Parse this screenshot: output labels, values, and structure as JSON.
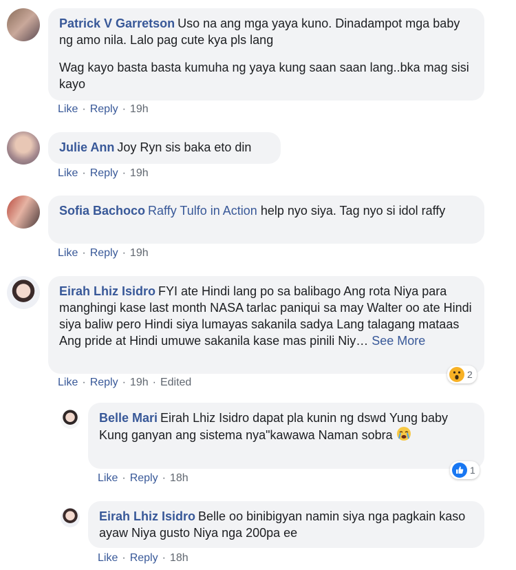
{
  "comments": [
    {
      "author": "Patrick V Garretson",
      "text1": "Uso na ang mga yaya kuno. Dinadampot mga baby ng amo nila. Lalo pag cute kya pls lang",
      "text2": "Wag kayo basta basta kumuha ng yaya kung saan saan lang..bka mag sisi kayo",
      "like": "Like",
      "reply": "Reply",
      "time": "19h"
    },
    {
      "author": "Julie Ann",
      "text": "Joy Ryn sis baka eto din",
      "like": "Like",
      "reply": "Reply",
      "time": "19h"
    },
    {
      "author": "Sofia Bachoco",
      "mention": "Raffy Tulfo in Action",
      "text": "help nyo siya. Tag nyo si idol raffy",
      "like": "Like",
      "reply": "Reply",
      "time": "19h"
    },
    {
      "author": "Eirah Lhiz Isidro",
      "text": "FYI ate Hindi lang po sa balibago Ang rota Niya para manghingi kase last month NASA tarlac paniqui sa may Walter oo ate Hindi siya baliw pero Hindi siya lumayas sakanila sadya Lang talagang mataas Ang pride at Hindi umuwe sakanila kase mas pinili Niy…",
      "see_more": "See More",
      "like": "Like",
      "reply": "Reply",
      "time": "19h",
      "edited": "Edited",
      "reaction_count": "2",
      "reaction_icon": "wow-emoji-icon"
    }
  ],
  "replies": [
    {
      "author": "Belle Mari",
      "text": "Eirah Lhiz Isidro dapat pla kunin ng dswd Yung baby Kung ganyan ang sistema nya\"kawawa Naman sobra",
      "like": "Like",
      "reply": "Reply",
      "time": "18h",
      "reaction_count": "1",
      "reaction_icon": "thumbs-up-icon"
    },
    {
      "author": "Eirah Lhiz Isidro",
      "text": "Belle oo binibigyan namin siya nga pagkain kaso ayaw Niya gusto Niya nga 200pa ee",
      "like": "Like",
      "reply": "Reply",
      "time": "18h"
    }
  ],
  "colors": {
    "link": "#385898",
    "bubble": "#f2f3f5",
    "meta": "#606770",
    "like_blue": "#1877f2"
  }
}
